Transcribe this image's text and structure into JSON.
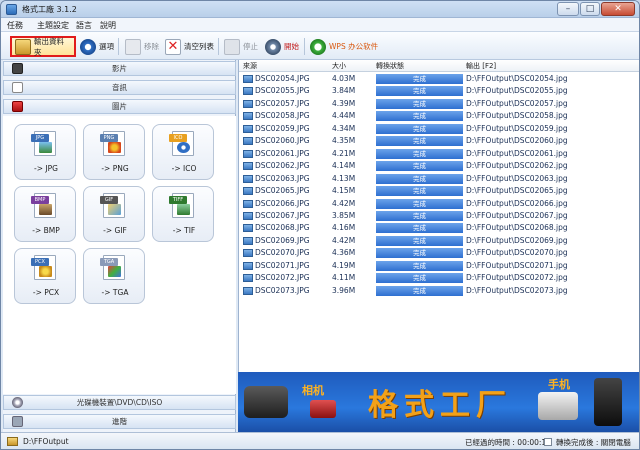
{
  "window": {
    "title": "格式工廠 3.1.2",
    "min": "–",
    "max": "□",
    "close": "✕"
  },
  "menu": [
    "任務",
    "主題設定",
    "語言",
    "說明"
  ],
  "toolbar": {
    "output_folder": "輸出資料夾",
    "options": "選項",
    "remove": "移除",
    "clear_list": "清空列表",
    "stop": "停止",
    "start": "開始",
    "wps": "WPS 办公软件"
  },
  "categories": {
    "video": "影片",
    "audio": "音訊",
    "picture": "圖片",
    "rom": "光碟機裝置\\DVD\\CD\\ISO",
    "advanced": "進階"
  },
  "formats": [
    {
      "tag": "JPG",
      "label": "-> JPG",
      "color": "#3b6fb6"
    },
    {
      "tag": "PNG",
      "label": "-> PNG",
      "color": "#5a7fb0"
    },
    {
      "tag": "ICO",
      "label": "-> ICO",
      "color": "#e8a020"
    },
    {
      "tag": "BMP",
      "label": "-> BMP",
      "color": "#7a3f9e"
    },
    {
      "tag": "GIF",
      "label": "-> GIF",
      "color": "#555555"
    },
    {
      "tag": "TIFF",
      "label": "-> TIF",
      "color": "#2f7a2f"
    },
    {
      "tag": "PCX",
      "label": "-> PCX",
      "color": "#3b6fb6"
    },
    {
      "tag": "TGA",
      "label": "-> TGA",
      "color": "#8a9ab8"
    }
  ],
  "table": {
    "headers": [
      "來源",
      "大小",
      "轉換狀態",
      "輸出 [F2]"
    ],
    "rows": [
      {
        "name": "DSC02054.JPG",
        "size": "4.03M",
        "status": "完成",
        "output": "D:\\FFOutput\\DSC02054.jpg"
      },
      {
        "name": "DSC02055.JPG",
        "size": "3.84M",
        "status": "完成",
        "output": "D:\\FFOutput\\DSC02055.jpg"
      },
      {
        "name": "DSC02057.JPG",
        "size": "4.39M",
        "status": "完成",
        "output": "D:\\FFOutput\\DSC02057.jpg"
      },
      {
        "name": "DSC02058.JPG",
        "size": "4.44M",
        "status": "完成",
        "output": "D:\\FFOutput\\DSC02058.jpg"
      },
      {
        "name": "DSC02059.JPG",
        "size": "4.34M",
        "status": "完成",
        "output": "D:\\FFOutput\\DSC02059.jpg"
      },
      {
        "name": "DSC02060.JPG",
        "size": "4.35M",
        "status": "完成",
        "output": "D:\\FFOutput\\DSC02060.jpg"
      },
      {
        "name": "DSC02061.JPG",
        "size": "4.21M",
        "status": "完成",
        "output": "D:\\FFOutput\\DSC02061.jpg"
      },
      {
        "name": "DSC02062.JPG",
        "size": "4.14M",
        "status": "完成",
        "output": "D:\\FFOutput\\DSC02062.jpg"
      },
      {
        "name": "DSC02063.JPG",
        "size": "4.13M",
        "status": "完成",
        "output": "D:\\FFOutput\\DSC02063.jpg"
      },
      {
        "name": "DSC02065.JPG",
        "size": "4.15M",
        "status": "完成",
        "output": "D:\\FFOutput\\DSC02065.jpg"
      },
      {
        "name": "DSC02066.JPG",
        "size": "4.42M",
        "status": "完成",
        "output": "D:\\FFOutput\\DSC02066.jpg"
      },
      {
        "name": "DSC02067.JPG",
        "size": "3.85M",
        "status": "完成",
        "output": "D:\\FFOutput\\DSC02067.jpg"
      },
      {
        "name": "DSC02068.JPG",
        "size": "4.16M",
        "status": "完成",
        "output": "D:\\FFOutput\\DSC02068.jpg"
      },
      {
        "name": "DSC02069.JPG",
        "size": "4.42M",
        "status": "完成",
        "output": "D:\\FFOutput\\DSC02069.jpg"
      },
      {
        "name": "DSC02070.JPG",
        "size": "4.36M",
        "status": "完成",
        "output": "D:\\FFOutput\\DSC02070.jpg"
      },
      {
        "name": "DSC02071.JPG",
        "size": "4.19M",
        "status": "完成",
        "output": "D:\\FFOutput\\DSC02071.jpg"
      },
      {
        "name": "DSC02072.JPG",
        "size": "4.11M",
        "status": "完成",
        "output": "D:\\FFOutput\\DSC02072.jpg"
      },
      {
        "name": "DSC02073.JPG",
        "size": "3.96M",
        "status": "完成",
        "output": "D:\\FFOutput\\DSC02073.jpg"
      }
    ]
  },
  "banner": {
    "title": "格式工厂",
    "camera": "相机",
    "phone": "手机"
  },
  "status": {
    "output_path": "D:\\FFOutput",
    "elapsed_label": "已經過的時間 : 00:00:16",
    "after_done": "轉換完成後 : 關閉電腦"
  }
}
